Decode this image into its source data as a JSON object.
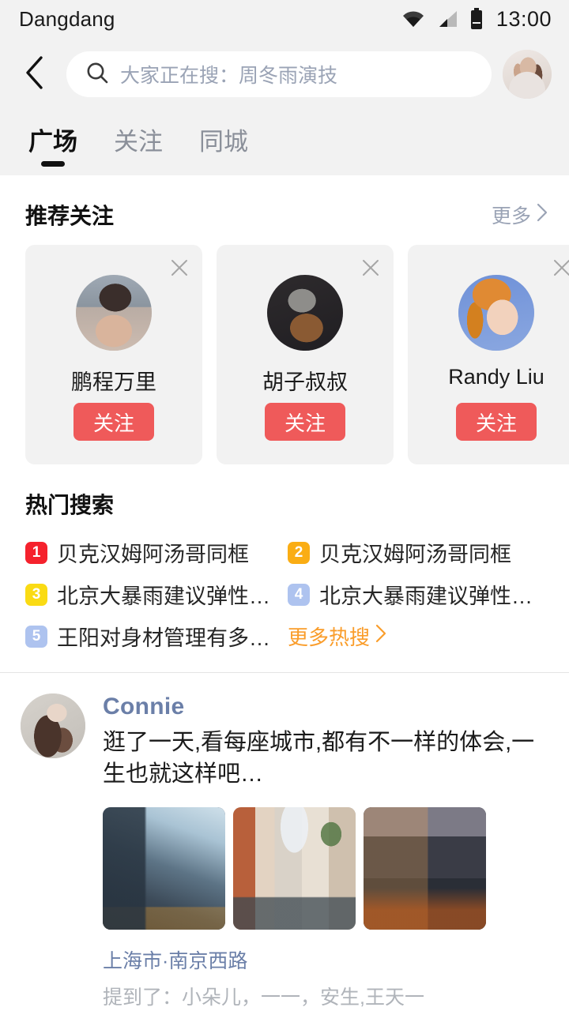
{
  "status_bar": {
    "carrier": "Dangdang",
    "time": "13:00",
    "icons": [
      "wifi-icon",
      "signal-icon",
      "battery-icon"
    ]
  },
  "header": {
    "back_icon": "chevron-left-icon",
    "search": {
      "icon": "search-icon",
      "placeholder": "大家正在搜：周冬雨演技",
      "value": ""
    },
    "profile_avatar": "user-avatar"
  },
  "tabs": [
    {
      "label": "广场",
      "active": true
    },
    {
      "label": "关注",
      "active": false
    },
    {
      "label": "同城",
      "active": false
    }
  ],
  "recommend": {
    "title": "推荐关注",
    "more_label": "更多",
    "more_icon": "chevron-right-icon",
    "close_icon": "close-icon",
    "users": [
      {
        "name": "鹏程万里",
        "follow_label": "关注"
      },
      {
        "name": "胡子叔叔",
        "follow_label": "关注"
      },
      {
        "name": "Randy Liu",
        "follow_label": "关注"
      }
    ]
  },
  "hot_search": {
    "title": "热门搜索",
    "items": [
      {
        "rank": "1",
        "text": "贝克汉姆阿汤哥同框",
        "color": "#f5222d"
      },
      {
        "rank": "2",
        "text": "贝克汉姆阿汤哥同框",
        "color": "#faad14"
      },
      {
        "rank": "3",
        "text": "北京大暴雨建议弹性…",
        "color": "#fadb14"
      },
      {
        "rank": "4",
        "text": "北京大暴雨建议弹性…",
        "color": "#aec3ef"
      },
      {
        "rank": "5",
        "text": "王阳对身材管理有多…",
        "color": "#aec3ef"
      }
    ],
    "more_label": "更多热搜",
    "more_icon": "chevron-right-icon",
    "more_color": "#fa9d2b"
  },
  "feed": [
    {
      "user": "Connie",
      "text": "逛了一天,看每座城市,都有不一样的体会,一生也就这样吧…",
      "images": [
        "city-street-photo",
        "venice-canal-photo",
        "waterfront-skyline-photo"
      ],
      "location": "上海市·南京西路",
      "mentions": "提到了：小朵儿，一一，安生,王天一"
    }
  ],
  "theme": {
    "accent": "#ef5a5a",
    "page_bg": "#ffffff",
    "chrome_bg": "#f2f2f2",
    "card_bg": "#f2f2f2",
    "link_blue": "#6b7fa8"
  }
}
